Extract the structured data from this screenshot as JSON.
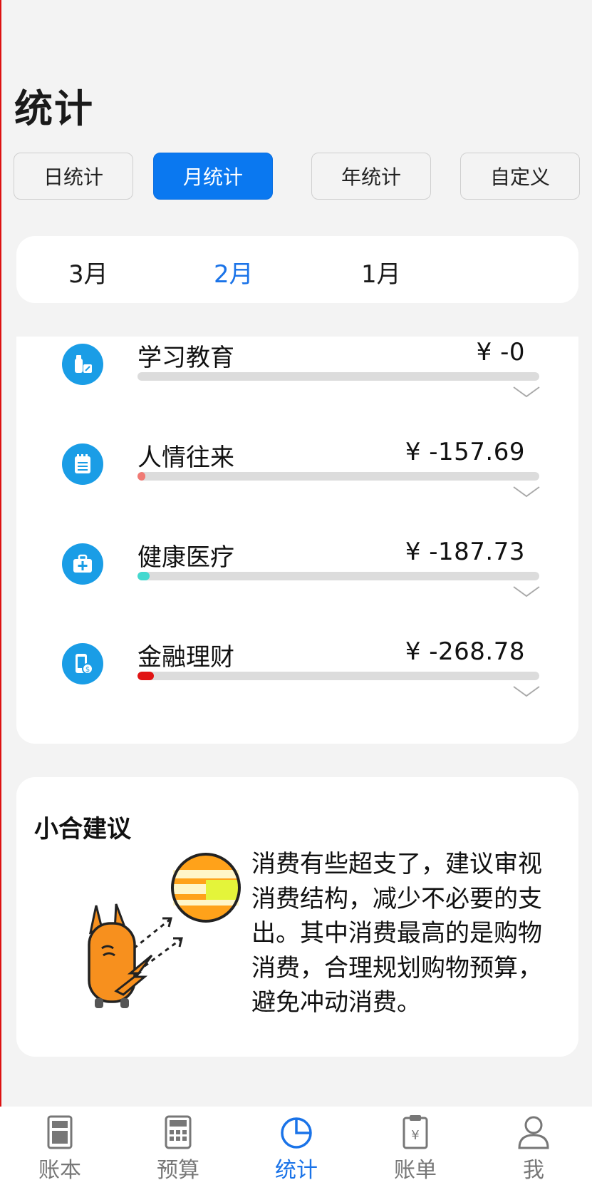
{
  "page": {
    "title": "统计"
  },
  "tabs": [
    {
      "label": "日统计",
      "active": false
    },
    {
      "label": "月统计",
      "active": true
    },
    {
      "label": "年统计",
      "active": false
    },
    {
      "label": "自定义",
      "active": false
    }
  ],
  "months": [
    {
      "label": "3月",
      "active": false
    },
    {
      "label": "2月",
      "active": true
    },
    {
      "label": "1月",
      "active": false
    }
  ],
  "categories": [
    {
      "name": "学习教育",
      "amount": "¥ -0",
      "icon": "bottle-icon",
      "fill_color": "#dcdcdc",
      "fill_fraction": 0.0
    },
    {
      "name": "人情往来",
      "amount": "¥ -157.69",
      "icon": "notepad-icon",
      "fill_color": "#f07a74",
      "fill_fraction": 0.02
    },
    {
      "name": "健康医疗",
      "amount": "¥ -187.73",
      "icon": "medkit-icon",
      "fill_color": "#44d8cf",
      "fill_fraction": 0.03
    },
    {
      "name": "金融理财",
      "amount": "¥ -268.78",
      "icon": "phone-money-icon",
      "fill_color": "#e11414",
      "fill_fraction": 0.04
    }
  ],
  "advice": {
    "title": "小合建议",
    "text": "消费有些超支了，建议审视消费结构，减少不必要的支出。其中消费最高的是购物消费，合理规划购物预算，避免冲动消费。"
  },
  "bottom_nav": [
    {
      "label": "账本",
      "icon": "ledger-icon",
      "active": false
    },
    {
      "label": "预算",
      "icon": "calculator-icon",
      "active": false
    },
    {
      "label": "统计",
      "icon": "pie-chart-icon",
      "active": true
    },
    {
      "label": "账单",
      "icon": "bill-icon",
      "active": false
    },
    {
      "label": "我",
      "icon": "person-icon",
      "active": false
    }
  ],
  "colors": {
    "accent": "#0a78f0",
    "icon_bg": "#1a9de6",
    "active_text": "#1a73e8",
    "background": "#f3f3f3"
  }
}
